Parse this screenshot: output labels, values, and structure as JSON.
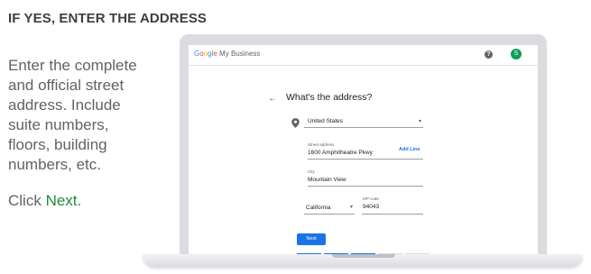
{
  "heading": "IF YES, ENTER THE ADDRESS",
  "instructions": {
    "line1": "Enter the complete and official street address. Include suite numbers, floors, building numbers, etc.",
    "click_prefix": "Click ",
    "next_word": "Next",
    "period": "."
  },
  "app": {
    "brand_google": [
      "G",
      "o",
      "o",
      "g",
      "l",
      "e"
    ],
    "brand_rest": " My Business",
    "help_icon": "?",
    "avatar_letter": "S"
  },
  "form": {
    "back_icon": "←",
    "title": "What's the address?",
    "country": "United States",
    "street_label": "Street address",
    "street_value": "1600 Amphitheatre Pkwy",
    "add_line": "Add Line",
    "city_label": "City",
    "city_value": "Mountain View",
    "state_value": "California",
    "zip_label": "ZIP code",
    "zip_value": "94043",
    "next_button": "Next"
  },
  "progress": {
    "completed_steps": 3,
    "total_steps": 5
  },
  "colors": {
    "accent": "#1a73e8",
    "green": "#1e8e3e",
    "avatar": "#0f9d58",
    "progress_done": "#1a73e8",
    "progress_todo": "#dadce0"
  },
  "icons": [
    "pin-icon",
    "help-icon",
    "back-arrow-icon",
    "dropdown-caret-icon"
  ]
}
